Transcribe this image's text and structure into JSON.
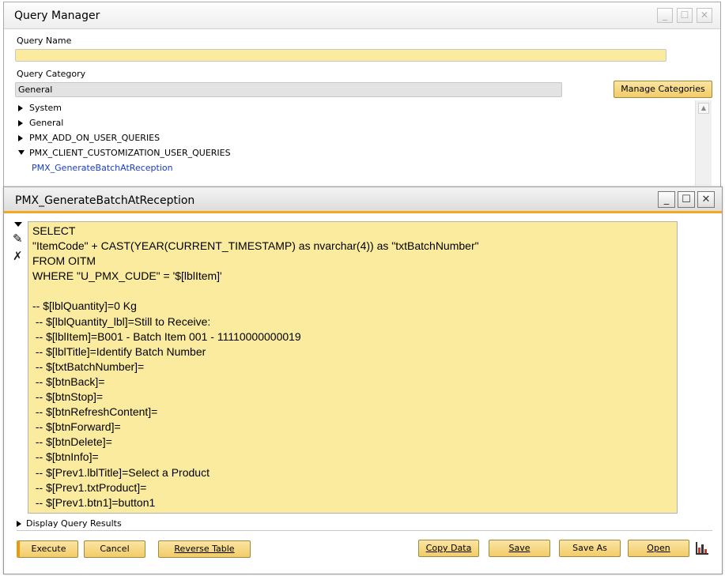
{
  "query_manager": {
    "title": "Query Manager",
    "query_name_label": "Query Name",
    "query_name_value": "",
    "query_category_label": "Query Category",
    "query_category_value": "General",
    "manage_categories_label": "Manage Categories",
    "tree": [
      {
        "label": "System",
        "expanded": false
      },
      {
        "label": "General",
        "expanded": false
      },
      {
        "label": "PMX_ADD_ON_USER_QUERIES",
        "expanded": false
      },
      {
        "label": "PMX_CLIENT_CUSTOMIZATION_USER_QUERIES",
        "expanded": true
      }
    ],
    "tree_child": "PMX_GenerateBatchAtReception"
  },
  "query_window": {
    "title": "PMX_GenerateBatchAtReception",
    "code": "SELECT\n\"ItemCode\" + CAST(YEAR(CURRENT_TIMESTAMP) as nvarchar(4)) as \"txtBatchNumber\"\nFROM OITM\nWHERE \"U_PMX_CUDE\" = '$[lblItem]'\n\n-- $[lblQuantity]=0 Kg\n -- $[lblQuantity_lbl]=Still to Receive:\n -- $[lblItem]=B001 - Batch Item 001 - 11110000000019\n -- $[lblTitle]=Identify Batch Number\n -- $[txtBatchNumber]=\n -- $[btnBack]=\n -- $[btnStop]=\n -- $[btnRefreshContent]=\n -- $[btnForward]=\n -- $[btnDelete]=\n -- $[btnInfo]=\n -- $[Prev1.lblTitle]=Select a Product\n -- $[Prev1.txtProduct]=\n -- $[Prev1.btn1]=button1",
    "display_results_label": "Display Query Results",
    "buttons": {
      "execute": "Execute",
      "cancel": "Cancel",
      "reverse_table": "Reverse Table",
      "copy_data": "Copy Data",
      "save": "Save",
      "save_as": "Save As",
      "open": "Open"
    }
  },
  "colors": {
    "accent": "#f4a81d",
    "field_yellow": "#fbeb9e",
    "button_yellow": "#f2cc67",
    "link_blue": "#1a3cc8"
  }
}
